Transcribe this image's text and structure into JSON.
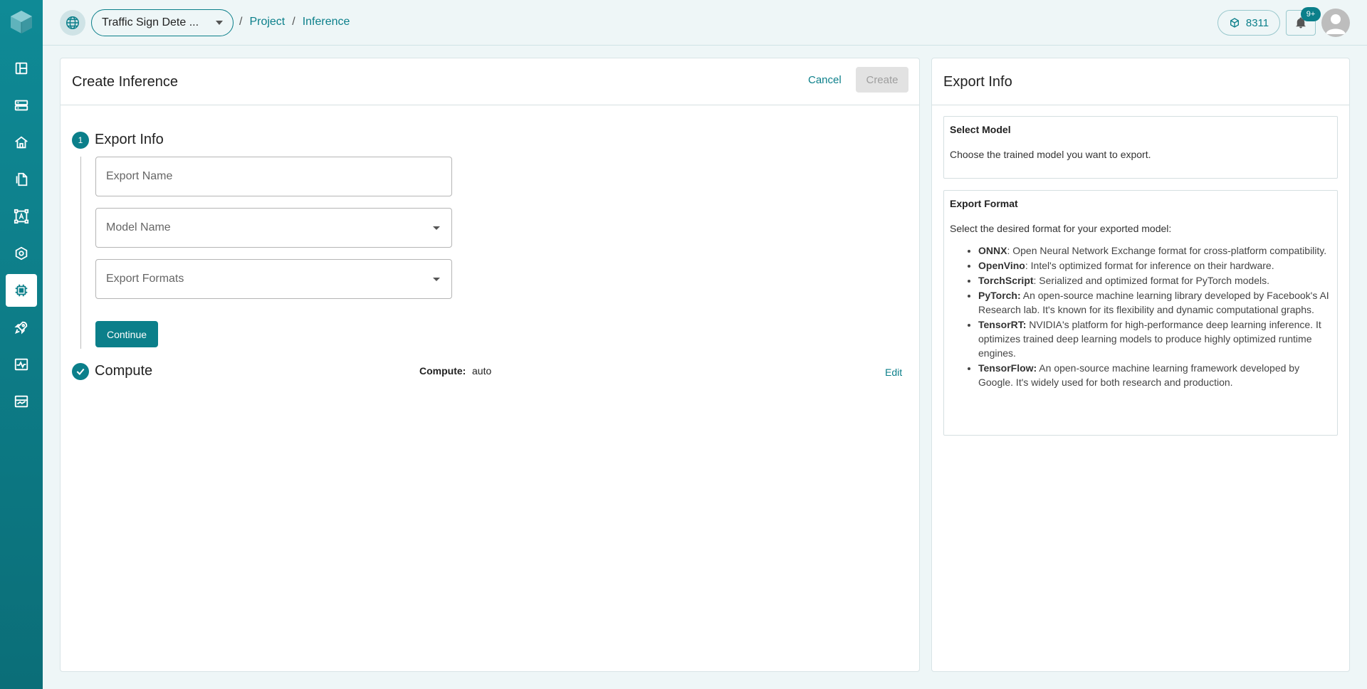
{
  "sidebar": {
    "logo": "cube-logo-icon",
    "items": [
      {
        "icon": "layout-icon"
      },
      {
        "icon": "storage-icon"
      },
      {
        "icon": "home-icon"
      },
      {
        "icon": "files-icon"
      },
      {
        "icon": "annotate-icon"
      },
      {
        "icon": "model-icon"
      },
      {
        "icon": "chip-icon",
        "active": true
      },
      {
        "icon": "rocket-icon"
      },
      {
        "icon": "monitor-icon"
      },
      {
        "icon": "dashboard-icon"
      }
    ]
  },
  "header": {
    "project": "Traffic Sign Dete ...",
    "breadcrumbs": [
      "Project",
      "Inference"
    ],
    "credits": "8311",
    "notifications_badge": "9+"
  },
  "main": {
    "title": "Create Inference",
    "cancel_label": "Cancel",
    "create_label": "Create",
    "step1": {
      "number": "1",
      "title": "Export Info",
      "export_name_placeholder": "Export Name",
      "model_name_placeholder": "Model Name",
      "export_formats_placeholder": "Export Formats",
      "continue_label": "Continue"
    },
    "step2": {
      "title": "Compute",
      "compute_label": "Compute:",
      "compute_value": "auto",
      "edit_label": "Edit"
    }
  },
  "side": {
    "title": "Export Info",
    "select_model": {
      "heading": "Select Model",
      "text": "Choose the trained model you want to export."
    },
    "export_format": {
      "heading": "Export Format",
      "text": "Select the desired format for your exported model:",
      "items": [
        {
          "name": "ONNX",
          "desc": ": Open Neural Network Exchange format for cross-platform compatibility."
        },
        {
          "name": "OpenVino",
          "desc": ": Intel's optimized format for inference on their hardware."
        },
        {
          "name": "TorchScript",
          "desc": ": Serialized and optimized format for PyTorch models."
        },
        {
          "name": "PyTorch:",
          "desc": " An open-source machine learning library developed by Facebook's AI Research lab. It's known for its flexibility and dynamic computational graphs."
        },
        {
          "name": "TensorRT:",
          "desc": " NVIDIA's platform for high-performance deep learning inference. It optimizes trained deep learning models to produce highly optimized runtime engines."
        },
        {
          "name": "TensorFlow:",
          "desc": " An open-source machine learning framework developed by Google. It's widely used for both research and production."
        }
      ]
    }
  }
}
